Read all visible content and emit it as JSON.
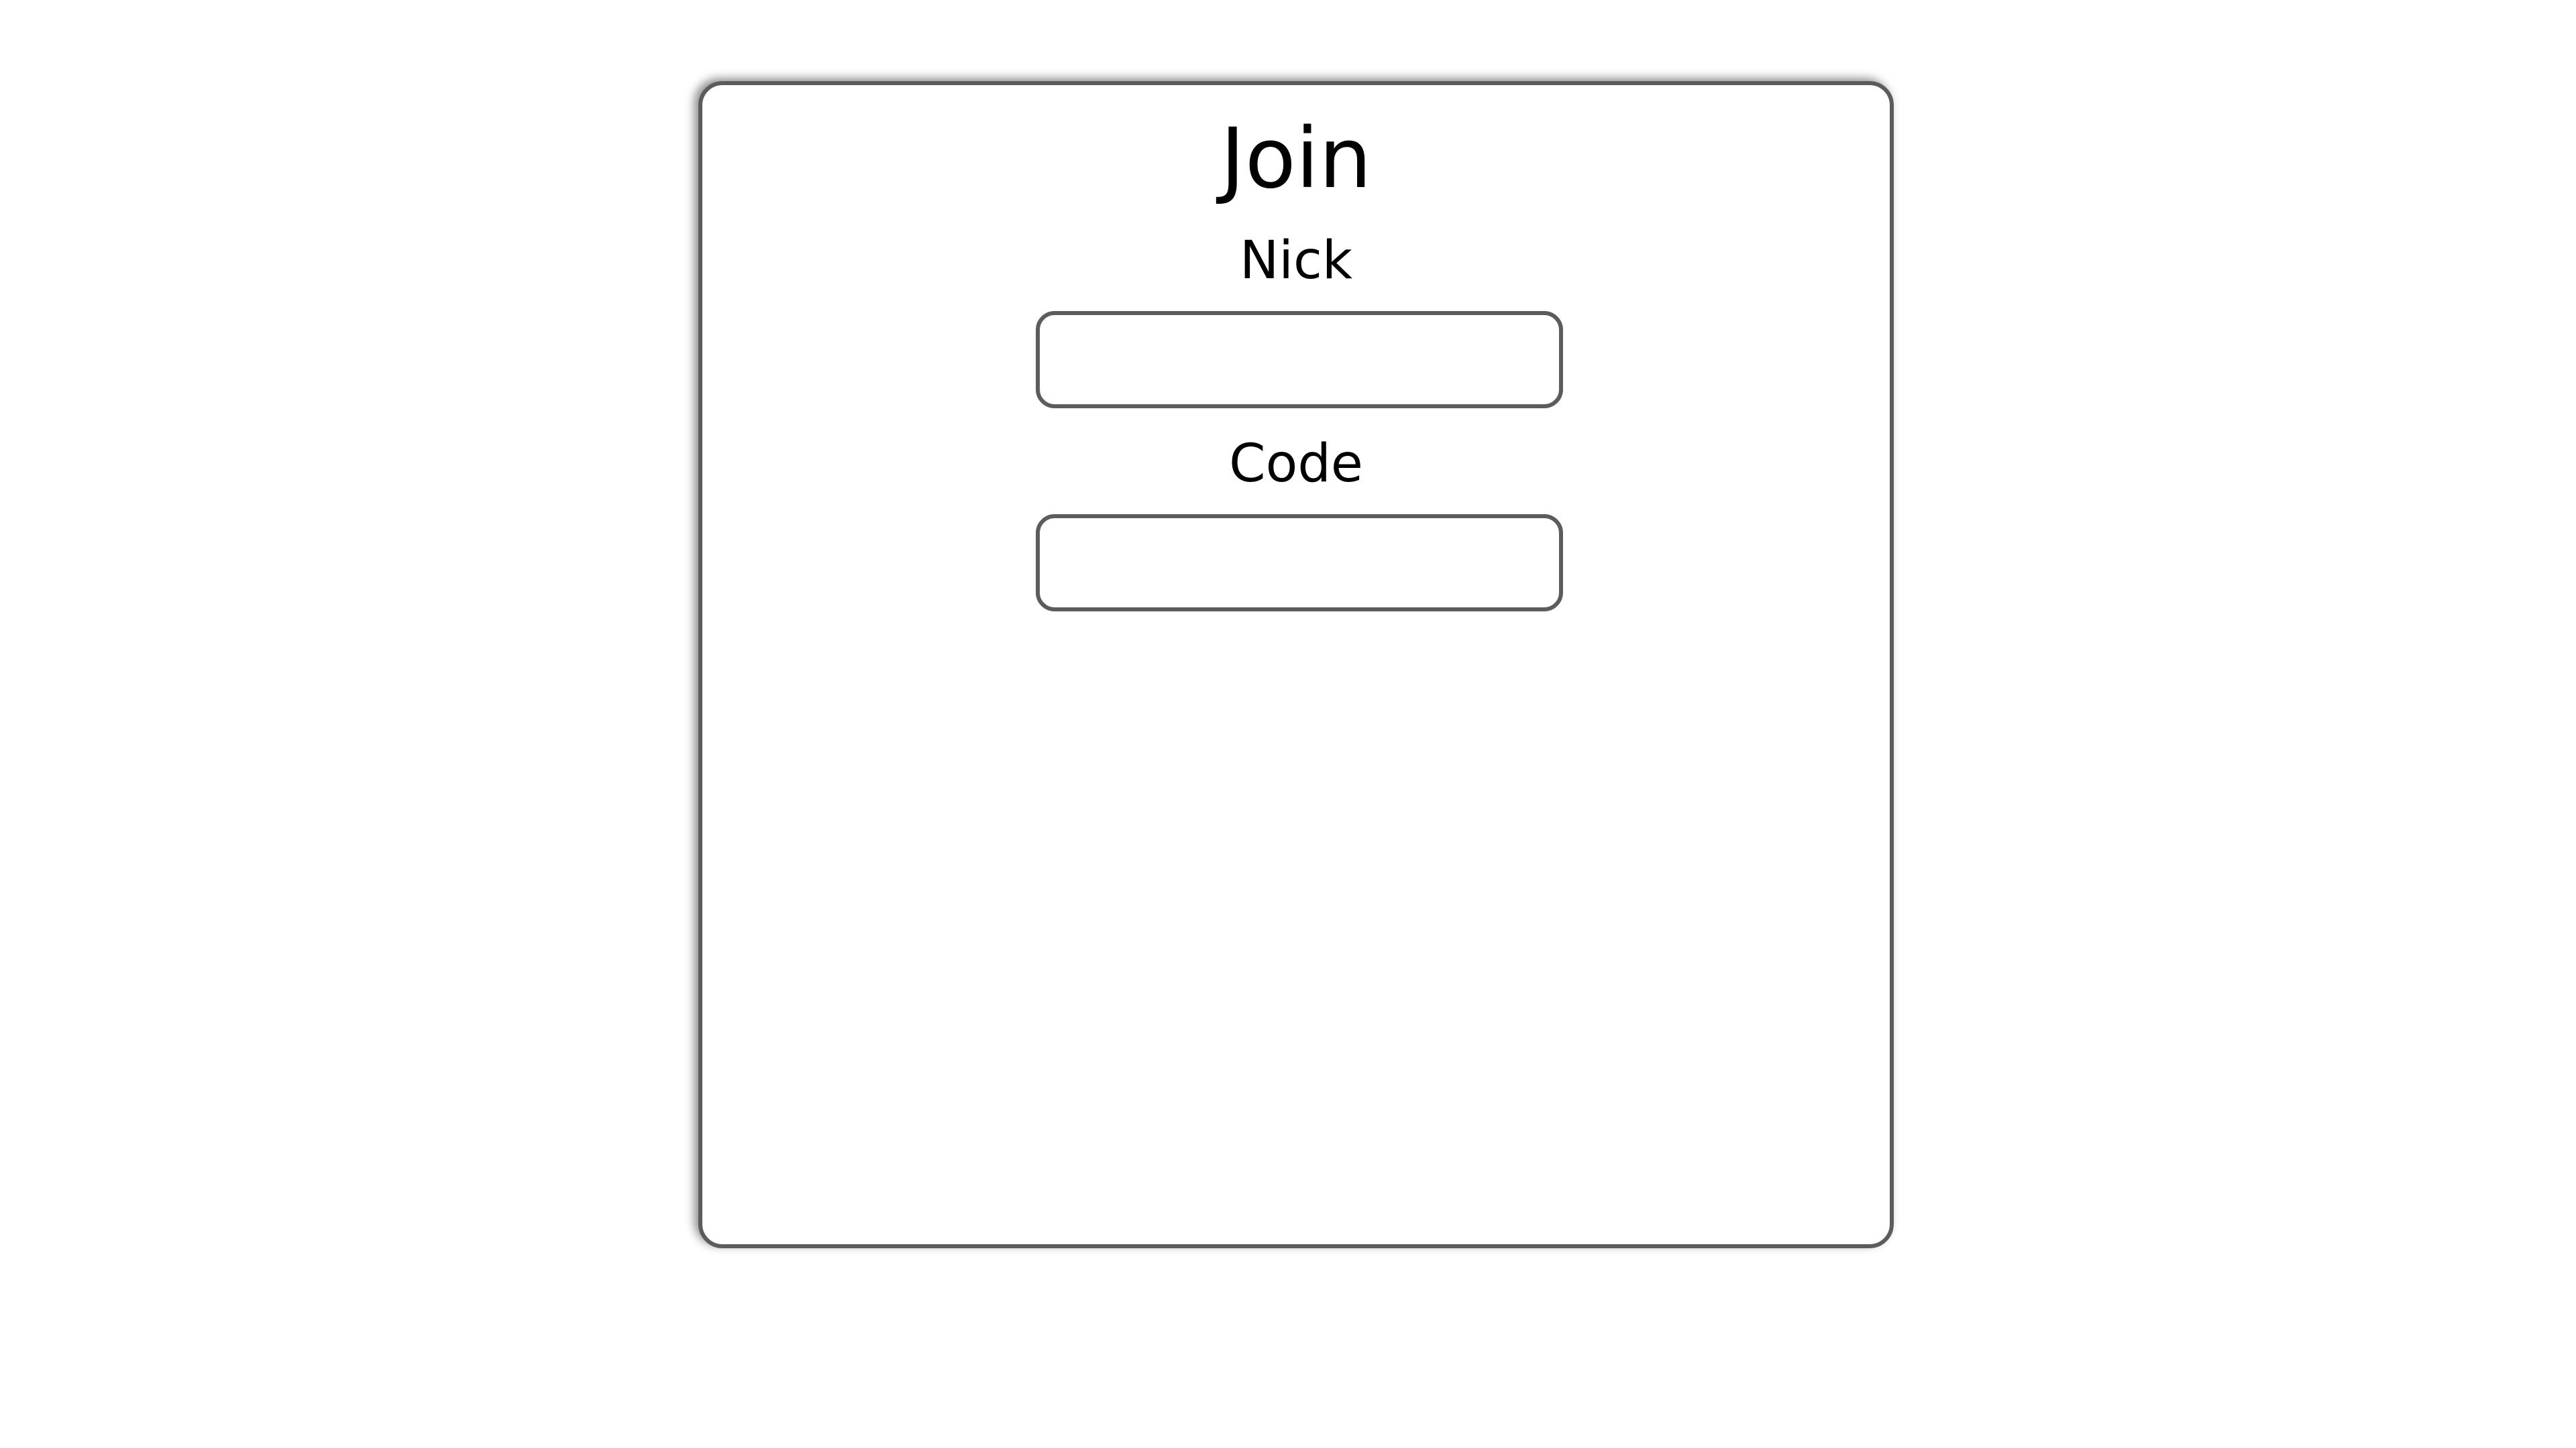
{
  "form": {
    "title": "Join",
    "fields": [
      {
        "label": "Nick",
        "value": "",
        "placeholder": ""
      },
      {
        "label": "Code",
        "value": "",
        "placeholder": ""
      }
    ]
  },
  "colors": {
    "background": "#ffffff",
    "border": "#5c5c5c",
    "text": "#000000"
  }
}
